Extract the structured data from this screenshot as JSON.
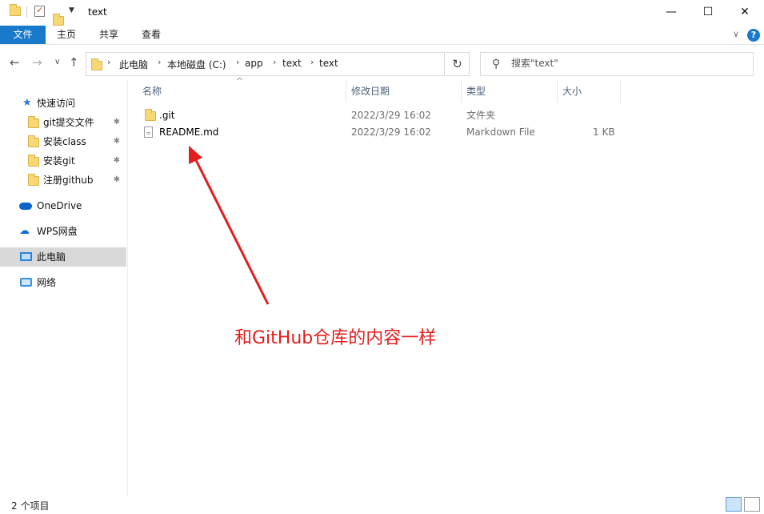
{
  "window": {
    "title": "text",
    "controls": {
      "minimize": "—",
      "maximize": "☐",
      "close": "✕"
    }
  },
  "ribbon": {
    "tabs": [
      "文件",
      "主页",
      "共享",
      "查看"
    ],
    "help": "?"
  },
  "address": {
    "crumbs": [
      "此电脑",
      "本地磁盘 (C:)",
      "app",
      "text",
      "text"
    ]
  },
  "search": {
    "placeholder": "搜索\"text\""
  },
  "navpane": {
    "quick_access": "快速访问",
    "pinned": [
      "git提交文件",
      "安装class",
      "安装git",
      "注册github"
    ],
    "onedrive": "OneDrive",
    "wps": "WPS网盘",
    "this_pc": "此电脑",
    "network": "网络"
  },
  "columns": [
    "名称",
    "修改日期",
    "类型",
    "大小"
  ],
  "files": [
    {
      "name": ".git",
      "date": "2022/3/29 16:02",
      "type": "文件夹",
      "size": "",
      "icon": "folder-icon"
    },
    {
      "name": "README.md",
      "date": "2022/3/29 16:02",
      "type": "Markdown File",
      "size": "1 KB",
      "icon": "file-icon"
    }
  ],
  "annotation": {
    "text": "和GitHub仓库的内容一样",
    "color": "#e31d1d"
  },
  "status": {
    "item_count": "2 个项目"
  },
  "colors": {
    "accent": "#1979ca",
    "selected": "#d9d9d9"
  }
}
